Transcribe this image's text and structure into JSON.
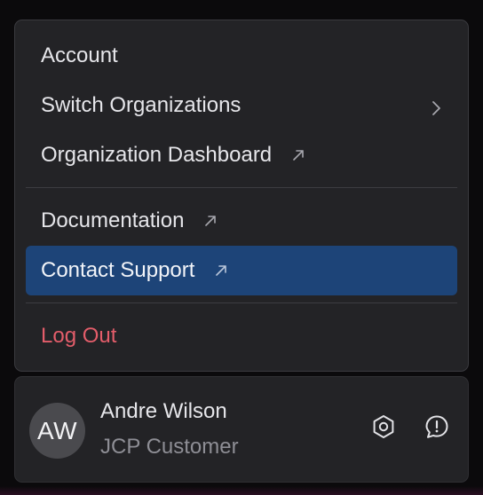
{
  "menu": {
    "account_label": "Account",
    "switch_org_label": "Switch Organizations",
    "org_dashboard_label": "Organization Dashboard",
    "documentation_label": "Documentation",
    "contact_support_label": "Contact Support",
    "logout_label": "Log Out"
  },
  "profile": {
    "initials": "AW",
    "name": "Andre Wilson",
    "role": "JCP Customer"
  },
  "icons": {
    "external": "external-link-icon",
    "chevron": "chevron-right-icon",
    "settings": "settings-hexagon-icon",
    "feedback": "feedback-alert-icon"
  },
  "colors": {
    "active_bg": "#1d4478",
    "logout": "#e35d6a",
    "panel_bg": "#232326"
  }
}
